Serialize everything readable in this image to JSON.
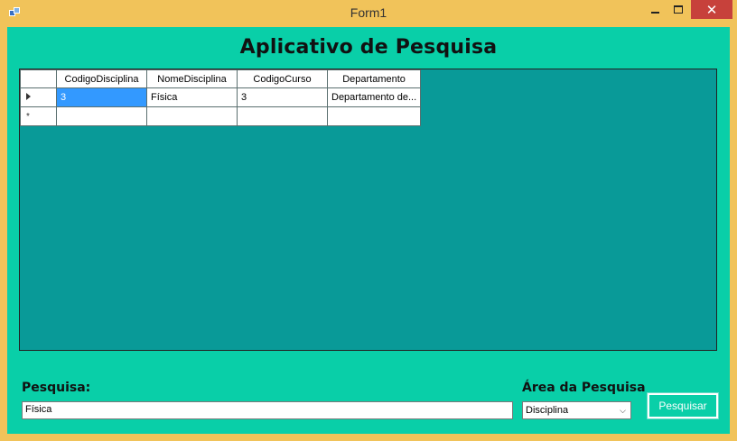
{
  "window": {
    "title": "Form1",
    "close_glyph": "✕"
  },
  "heading": "Aplicativo de Pesquisa",
  "grid": {
    "columns": [
      "CodigoDisciplina",
      "NomeDisciplina",
      "CodigoCurso",
      "Departamento"
    ],
    "rows": [
      [
        "3",
        "Física",
        "3",
        "Departamento de..."
      ]
    ],
    "new_row_glyph": "*"
  },
  "search": {
    "label": "Pesquisa:",
    "value": "Física"
  },
  "area": {
    "label": "Área da Pesquisa",
    "selected": "Disciplina"
  },
  "button": {
    "label": "Pesquisar"
  },
  "icons": [
    "app-icon",
    "minimize-icon",
    "maximize-icon",
    "close-icon",
    "current-row-arrow-icon",
    "chevron-down-icon"
  ]
}
